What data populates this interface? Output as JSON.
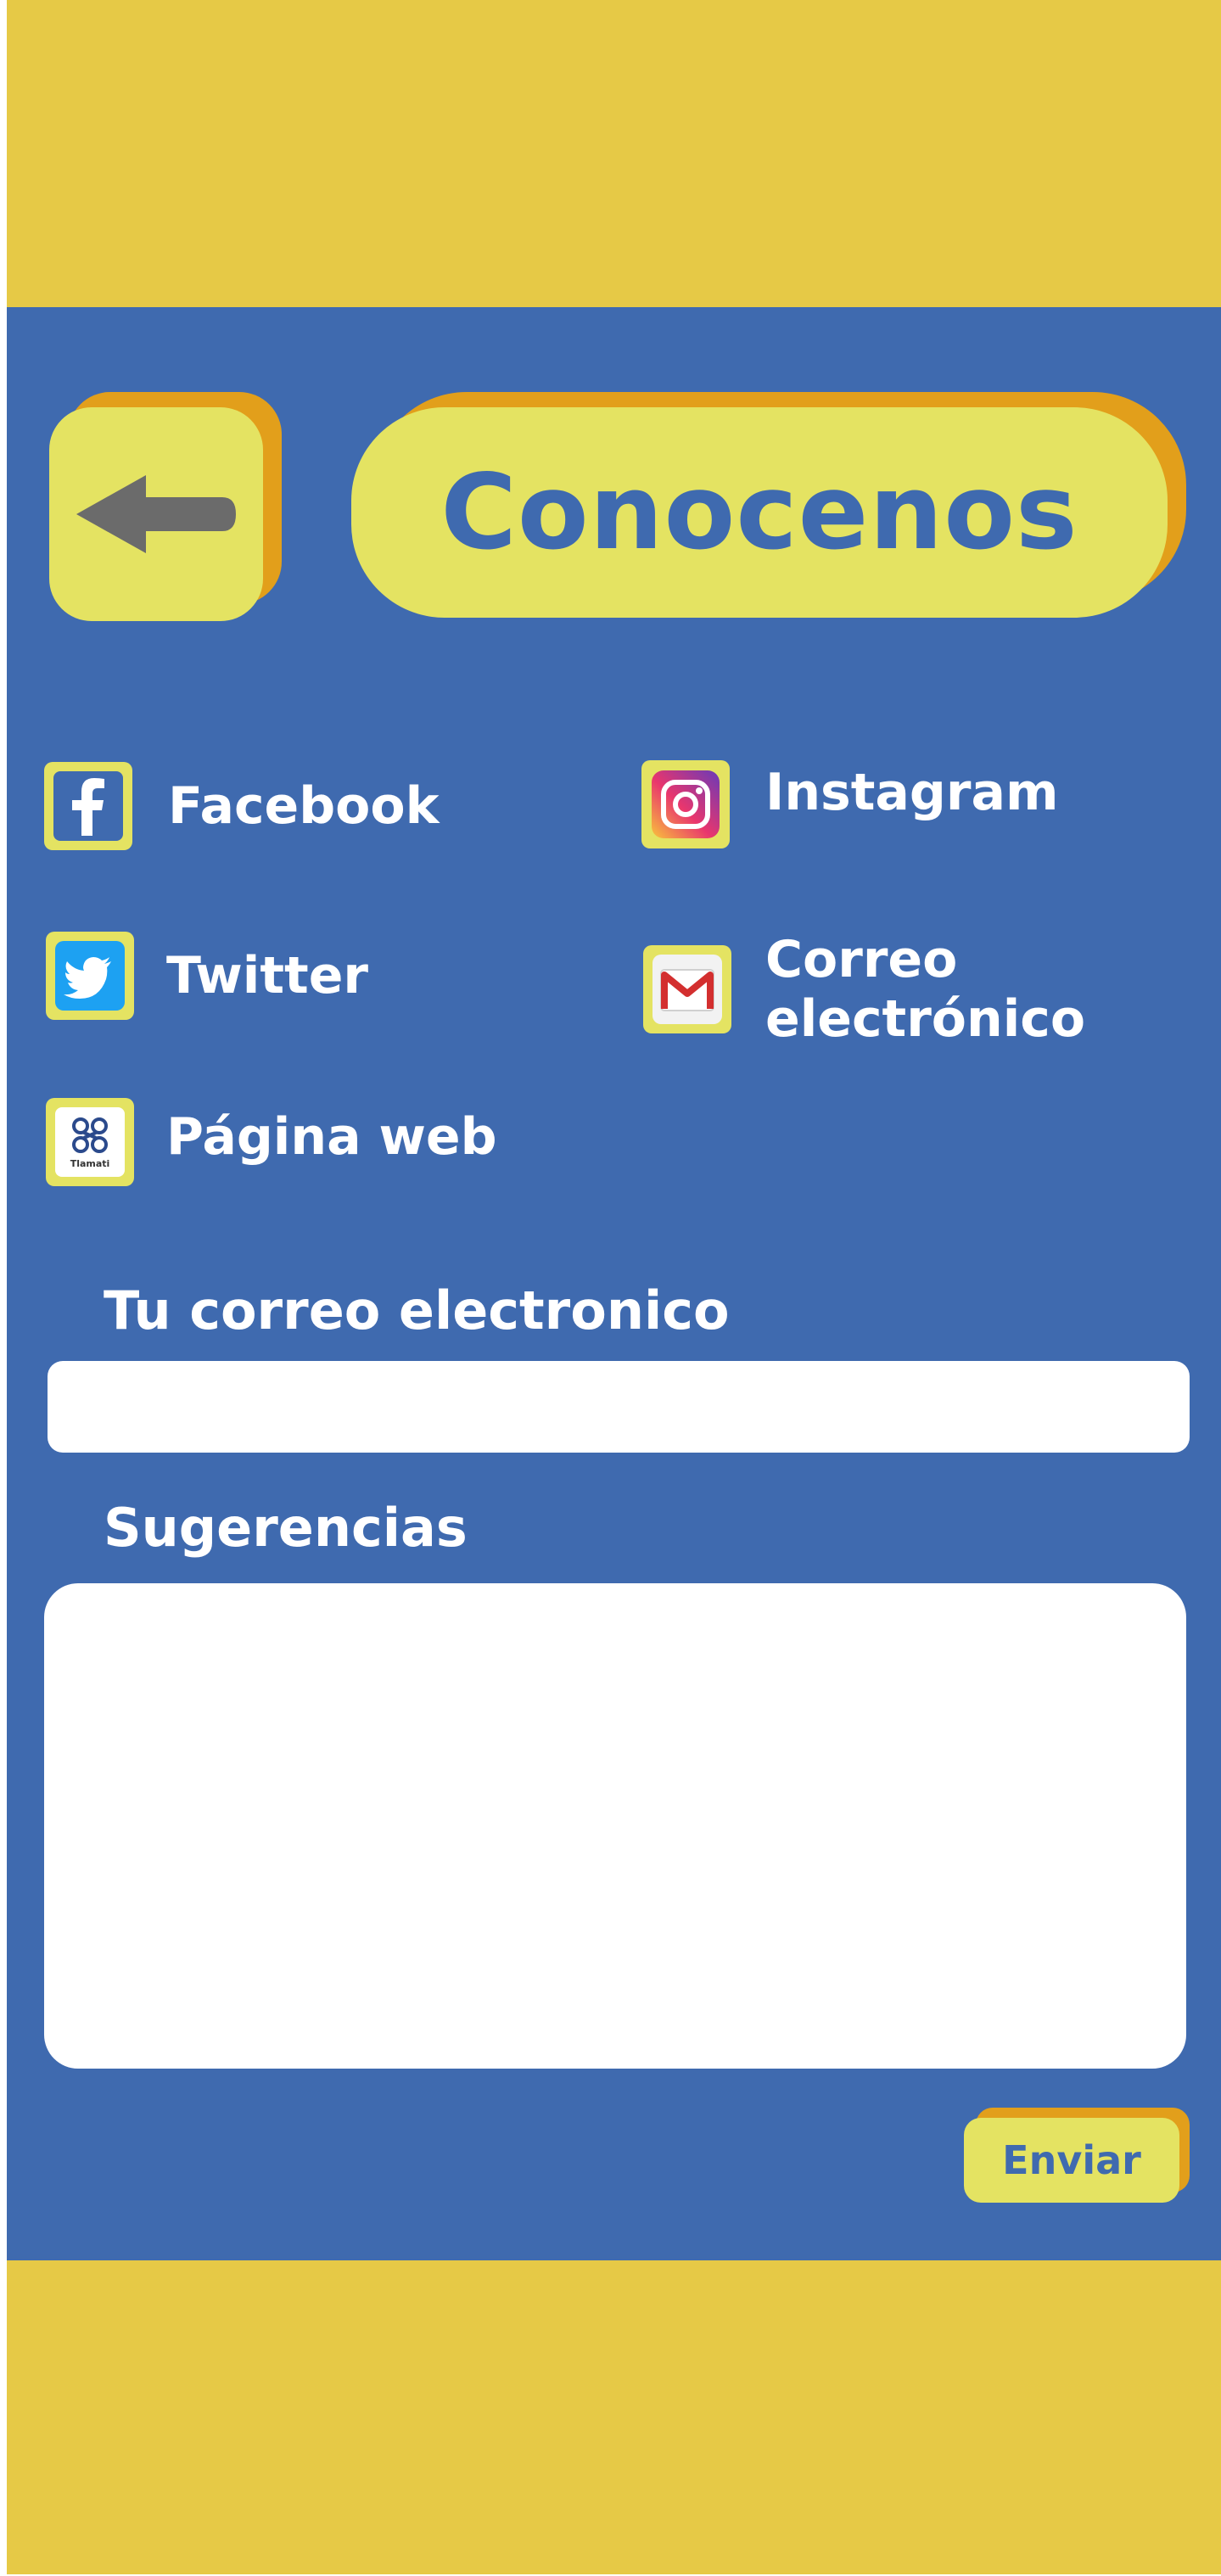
{
  "header": {
    "title": "Conocenos",
    "back_icon": "arrow-left-icon"
  },
  "social_links": {
    "facebook": {
      "label": "Facebook",
      "icon": "facebook-icon"
    },
    "instagram": {
      "label": "Instagram",
      "icon": "instagram-icon"
    },
    "twitter": {
      "label": "Twitter",
      "icon": "twitter-icon"
    },
    "email": {
      "label_line1": "Correo",
      "label_line2": "electrónico",
      "icon": "gmail-icon"
    },
    "website": {
      "label": "Página web",
      "icon": "tlamati-logo-icon",
      "logo_text": "Tlamati"
    }
  },
  "form": {
    "email_label": "Tu correo electronico",
    "email_value": "",
    "suggestions_label": "Sugerencias",
    "suggestions_value": "",
    "send_label": "Enviar"
  },
  "colors": {
    "band_yellow": "#e6c946",
    "background_blue": "#3f6aaf",
    "button_yellow": "#e4e362",
    "button_shadow_orange": "#e29f1b",
    "back_arrow_gray": "#6b6b6b"
  }
}
